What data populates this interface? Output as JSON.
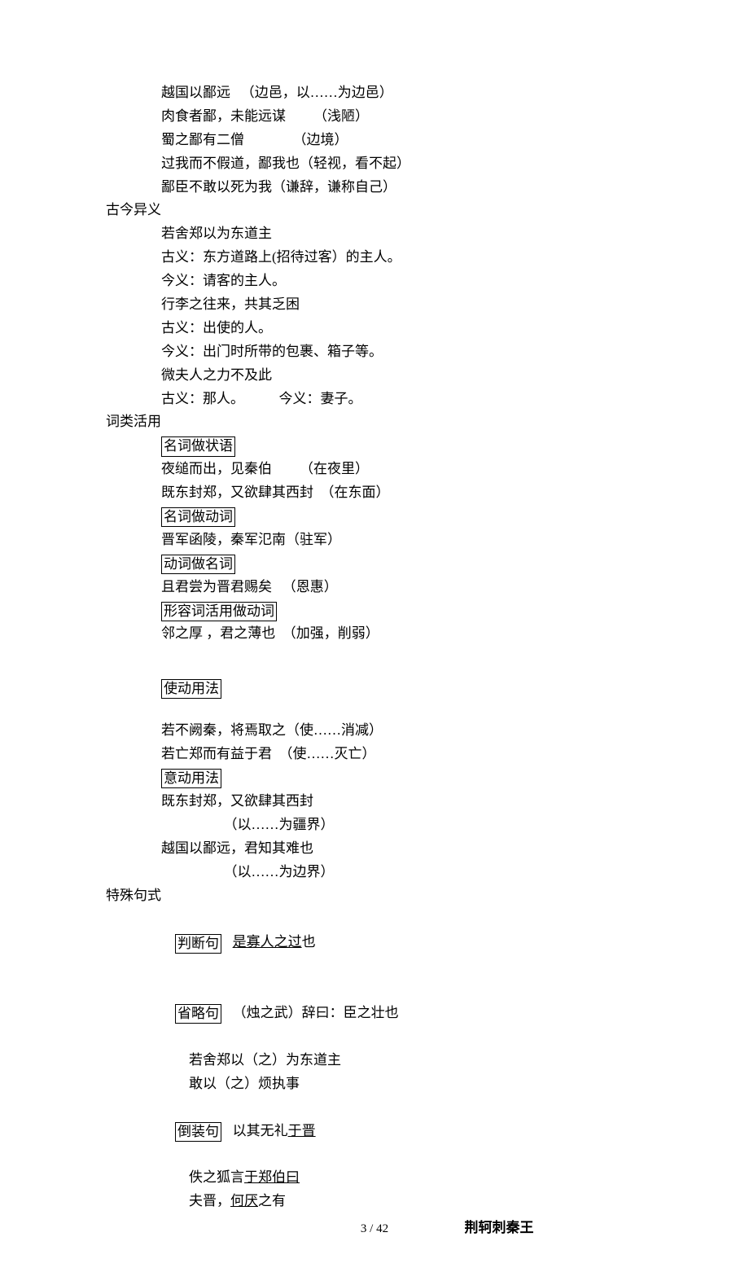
{
  "l1": "越国以鄙远   （边邑，以……为边邑）",
  "l2": "肉食者鄙，未能远谋        （浅陋）",
  "l3": "蜀之鄙有二僧              （边境）",
  "l4": "过我而不假道，鄙我也（轻视，看不起）",
  "l5": "鄙臣不敢以死为我（谦辞，谦称自己）",
  "h1": "古今异义",
  "l6": "若舍郑以为东道主",
  "l7": "古义：东方道路上(招待过客）的主人。",
  "l8": "今义：请客的主人。",
  "l9": "行李之往来，共其乏困",
  "l10": "古义：出使的人。",
  "l11": "今义：出门时所带的包裹、箱子等。",
  "l12": "微夫人之力不及此",
  "l13": "古义：那人。          今义：妻子。",
  "h2": "词类活用",
  "b1": "名词做状语",
  "l14": "夜缒而出，见秦伯        （在夜里）",
  "l15": "既东封郑，又欲肆其西封  （在东面）",
  "b2": "名词做动词",
  "l16": "晋军函陵，秦军氾南（驻军）",
  "b3": "动词做名词",
  "l17": "且君尝为晋君赐矣   （恩惠）",
  "b4": "形容词活用做动词",
  "l18": "邻之厚 ，君之薄也  （加强，削弱）",
  "b5": "使动用法",
  "l19": "若不阙秦，将焉取之（使……消减）",
  "l20": "若亡郑而有益于君  （使……灭亡）",
  "b6": "意动用法",
  "l21": "既东封郑，又欲肆其西封",
  "l22": "                  （以……为疆界）",
  "l23": "越国以鄙远，君知其难也",
  "l24": "                  （以……为边界）",
  "h3": "特殊句式",
  "b7": "判断句",
  "b8": "省略句",
  "b9": "倒装句",
  "s1a": "是寡人之过",
  "s1b": "也",
  "s2": "（烛之武）辞曰：臣之壮也",
  "s3": "若舍郑以（之）为东道主",
  "s4": "敢以（之）烦执事",
  "s5a": "以其无礼",
  "s5b": "于晋",
  "s6a": "佚之狐言",
  "s6b": "于郑伯曰",
  "s7a": "夫晋，",
  "s7b": "何厌",
  "s7c": "之有",
  "title": "荆轲刺秦王",
  "footer": "3  / 42"
}
